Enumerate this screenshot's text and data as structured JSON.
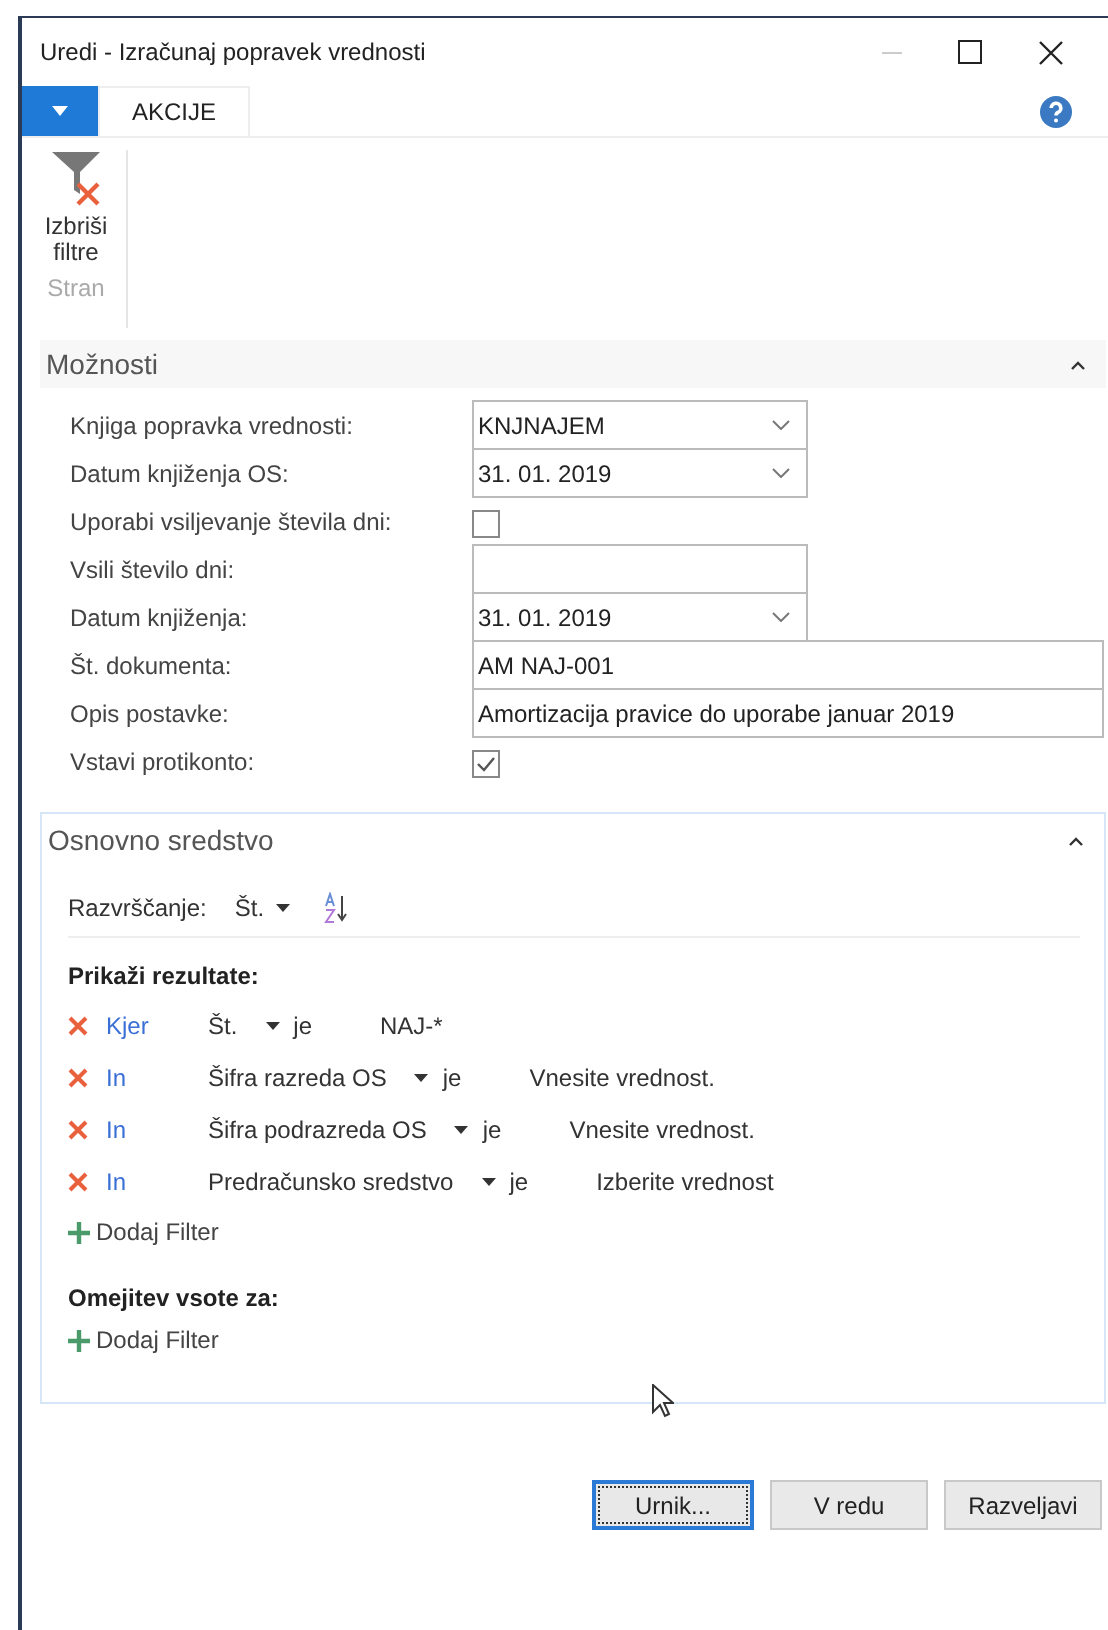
{
  "window": {
    "title": "Uredi - Izračunaj popravek vrednosti"
  },
  "tabs": [
    {
      "label": "AKCIJE",
      "selected": true
    }
  ],
  "ribbon": {
    "actions": [
      {
        "label": "Izbriši filtre"
      }
    ],
    "group": "Stran"
  },
  "options": {
    "title": "Možnosti",
    "expanded": true,
    "fields": [
      {
        "kind": "dropdown",
        "label": "Knjiga popravka vrednosti:",
        "value": "KNJNAJEM"
      },
      {
        "kind": "dropdown",
        "label": "Datum knjiženja OS:",
        "value": "31. 01. 2019"
      },
      {
        "kind": "checkbox",
        "label": "Uporabi vsiljevanje števila dni:",
        "checked": false
      },
      {
        "kind": "text",
        "label": "Vsili število dni:"
      },
      {
        "kind": "dropdown",
        "label": "Datum knjiženja:",
        "value": "31. 01. 2019"
      },
      {
        "kind": "wide",
        "label": "Št. dokumenta:",
        "value": "AM NAJ-001"
      },
      {
        "kind": "wide",
        "label": "Opis postavke:",
        "value": "Amortizacija pravice do uporabe januar 2019"
      },
      {
        "kind": "checkbox",
        "label": "Vstavi protikonto:",
        "checked": true
      }
    ]
  },
  "asset": {
    "title": "Osnovno sredstvo",
    "expanded": true,
    "sort_label": "Razvrščanje:",
    "sort_field": "Št.",
    "results_heading": "Prikaži rezultate:",
    "filters": [
      {
        "connector": "Kjer",
        "field": "Št.",
        "operator": "je",
        "value": "NAJ-*"
      },
      {
        "connector": "In",
        "field": "Šifra razreda OS",
        "operator": "je",
        "value": "Vnesite vrednost."
      },
      {
        "connector": "In",
        "field": "Šifra podrazreda OS",
        "operator": "je",
        "value": "Vnesite vrednost."
      },
      {
        "connector": "In",
        "field": "Predračunsko sredstvo",
        "operator": "je",
        "value": "Izberite vrednost"
      }
    ],
    "add_filter": "Dodaj Filter",
    "totals_heading": "Omejitev vsote za:",
    "totals_add_filter": "Dodaj Filter"
  },
  "buttons": [
    {
      "label": "Urnik...",
      "focused": true
    },
    {
      "label": "V redu",
      "focused": false
    },
    {
      "label": "Razveljavi",
      "focused": false
    }
  ]
}
